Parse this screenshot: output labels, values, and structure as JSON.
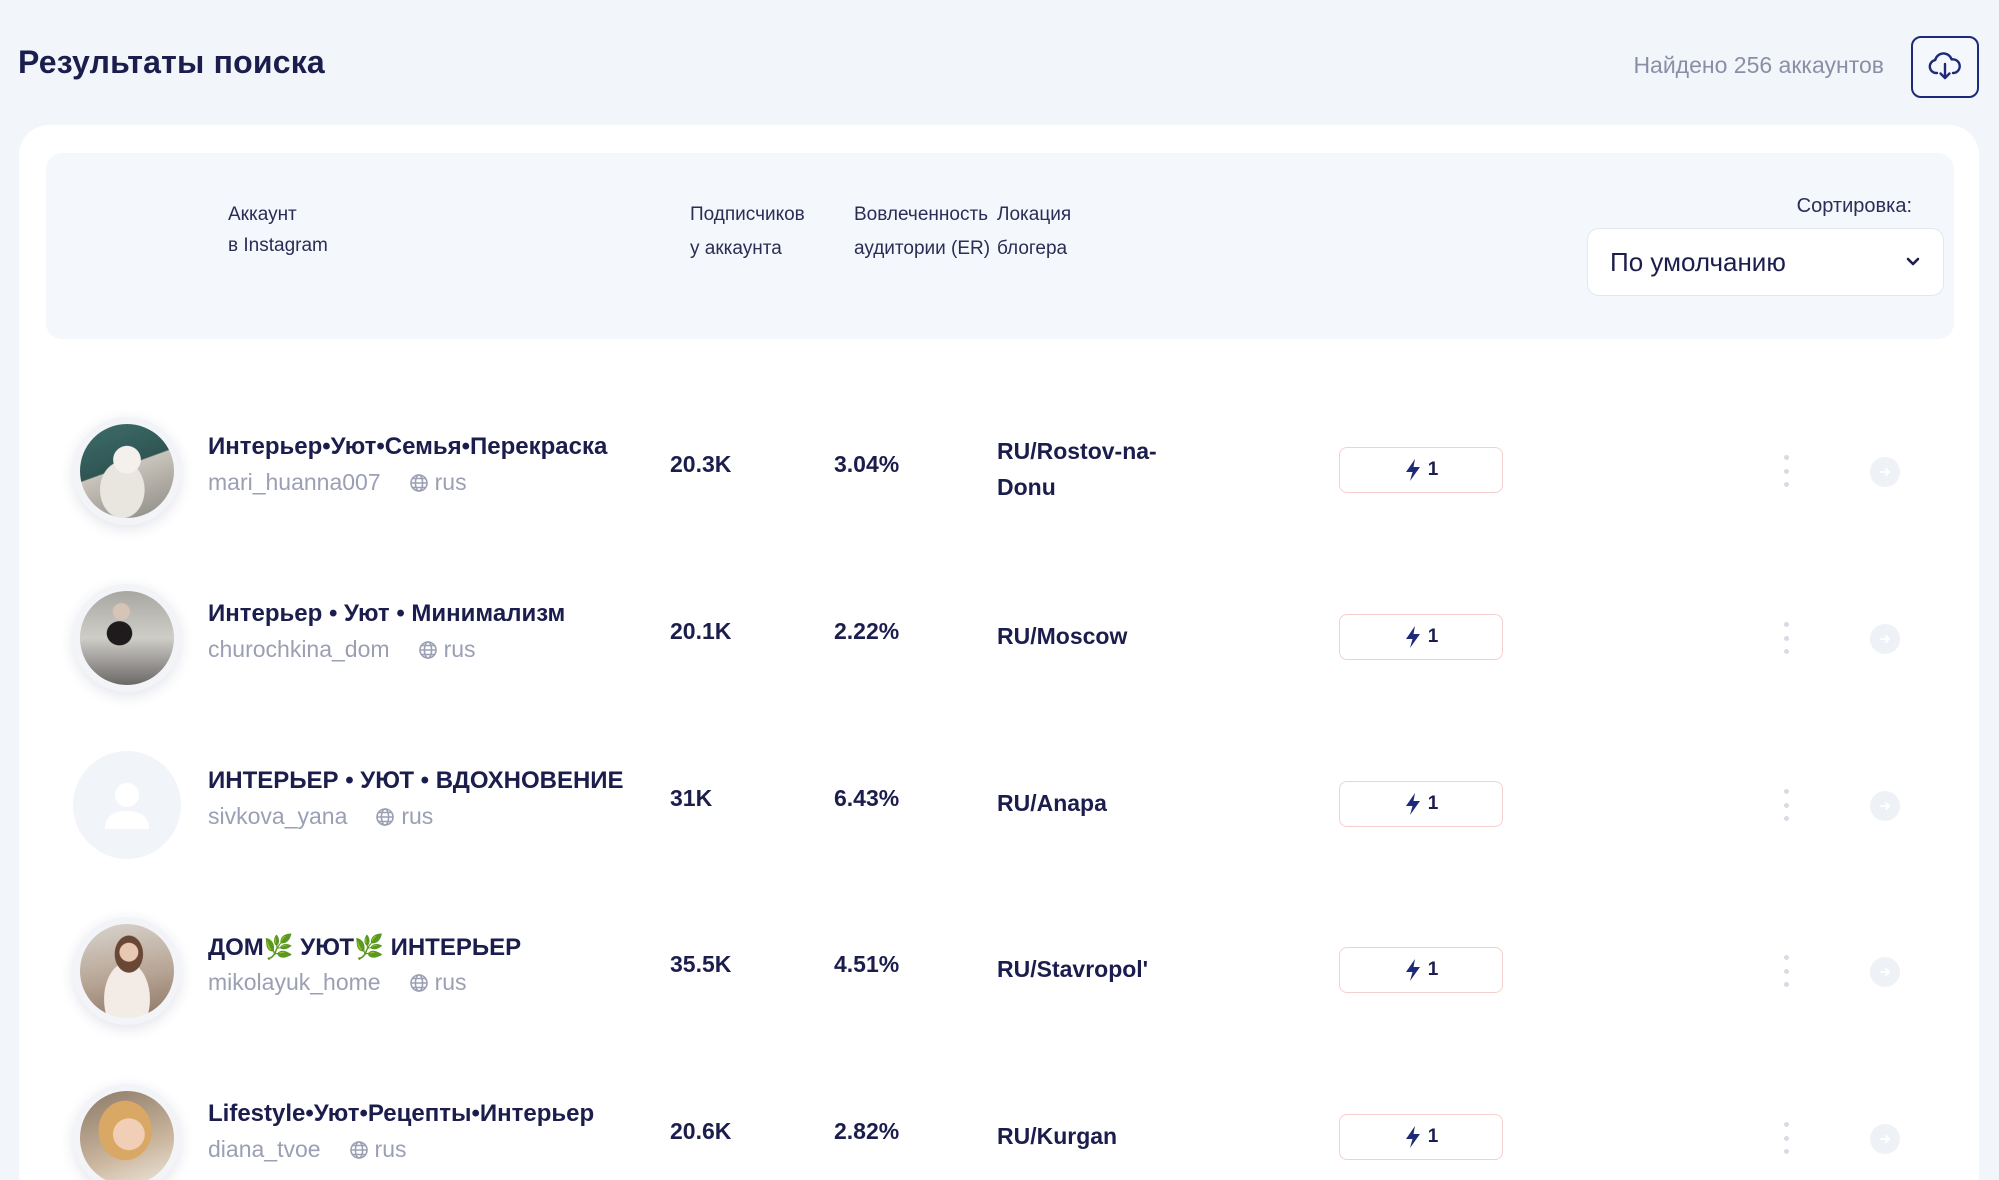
{
  "header": {
    "title": "Результаты поиска",
    "found": "Найдено 256 аккаунтов",
    "download_icon": "cloud-download-icon"
  },
  "table": {
    "columns": {
      "account_line1": "Аккаунт",
      "account_line2": "в Instagram",
      "followers_line1": "Подписчиков",
      "followers_line2": "у аккаунта",
      "er_line1": "Вовлеченность",
      "er_line2": "аудитории (ER)",
      "location_line1": "Локация",
      "location_line2": "блогера"
    },
    "sort": {
      "label": "Сортировка:",
      "value": "По умолчанию"
    }
  },
  "rows": [
    {
      "title": "Интерьер•Уют•Семья•Перекраска",
      "handle": "mari_huanna007",
      "lang": "rus",
      "followers": "20.3K",
      "er": "3.04%",
      "location_l1": "RU/Rostov-na-",
      "location_l2": "Donu",
      "boost": "1"
    },
    {
      "title": "Интерьер • Уют • Минимализм",
      "handle": "churochkina_dom",
      "lang": "rus",
      "followers": "20.1K",
      "er": "2.22%",
      "location_l1": "RU/Moscow",
      "location_l2": "",
      "boost": "1"
    },
    {
      "title": "ИНТЕРЬЕР • УЮТ • ВДОХНОВЕНИЕ",
      "handle": "sivkova_yana",
      "lang": "rus",
      "followers": "31K",
      "er": "6.43%",
      "location_l1": "RU/Anapa",
      "location_l2": "",
      "boost": "1"
    },
    {
      "title": "ДОМ🌿 УЮТ🌿 ИНТЕРЬЕР",
      "handle": "mikolayuk_home",
      "lang": "rus",
      "followers": "35.5K",
      "er": "4.51%",
      "location_l1": "RU/Stavropol'",
      "location_l2": "",
      "boost": "1"
    },
    {
      "title": "Lifestyle•Уют•Рецепты•Интерьер",
      "handle": "diana_tvoe",
      "lang": "rus",
      "followers": "20.6K",
      "er": "2.82%",
      "location_l1": "RU/Kurgan",
      "location_l2": "",
      "boost": "1"
    }
  ],
  "colors": {
    "primary_text": "#1b1d4d",
    "muted_text": "#9a9fb3",
    "accent_border": "#1e2a78",
    "boost_border": "#f6cfcf",
    "page_bg": "#f2f5fa"
  }
}
